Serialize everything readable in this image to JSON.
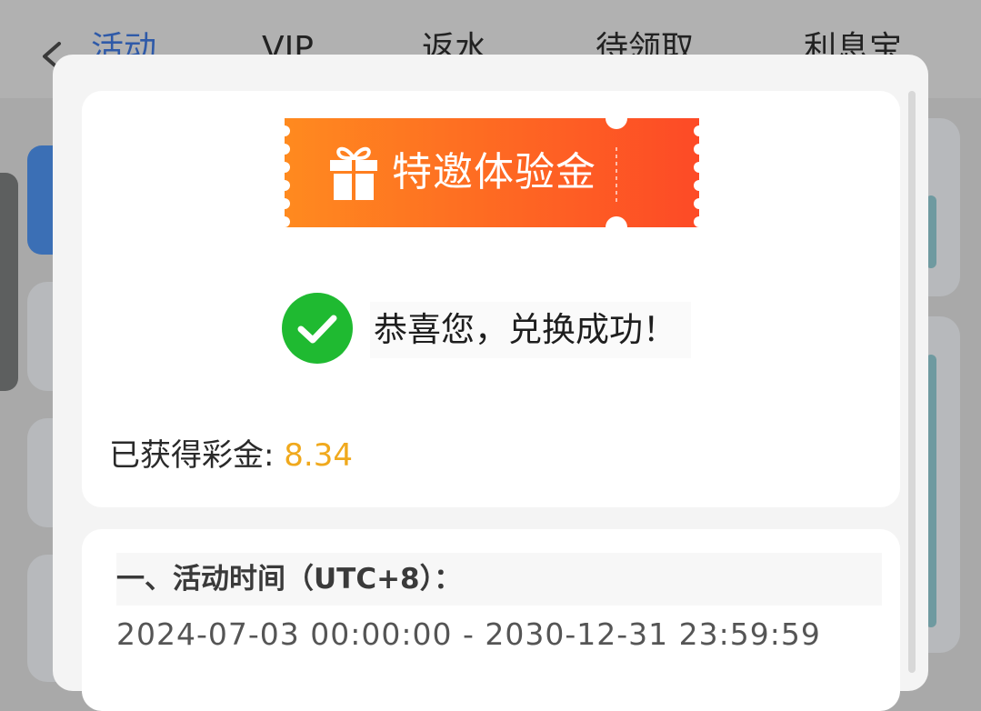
{
  "header": {
    "tabs": [
      {
        "label": "活动",
        "active": true
      },
      {
        "label": "VIP",
        "active": false
      },
      {
        "label": "返水",
        "active": false
      },
      {
        "label": "待领取",
        "active": false
      },
      {
        "label": "利息宝",
        "active": false
      }
    ]
  },
  "modal": {
    "ticket_label": "特邀体验金",
    "success_message": "恭喜您，兑换成功！",
    "bonus_label": "已获得彩金:",
    "bonus_value": "8.34",
    "section_title": "一、活动时间（UTC+8）：",
    "activity_time": "2024-07-03 00:00:00 - 2030-12-31 23:59:59"
  },
  "colors": {
    "ticket_start": "#ff8a1f",
    "ticket_end": "#fd4a26",
    "check_green": "#1fba31",
    "bonus_amount": "#f0a91d"
  },
  "icons": [
    "chevron-left-icon",
    "gift-icon",
    "check-circle-icon"
  ]
}
